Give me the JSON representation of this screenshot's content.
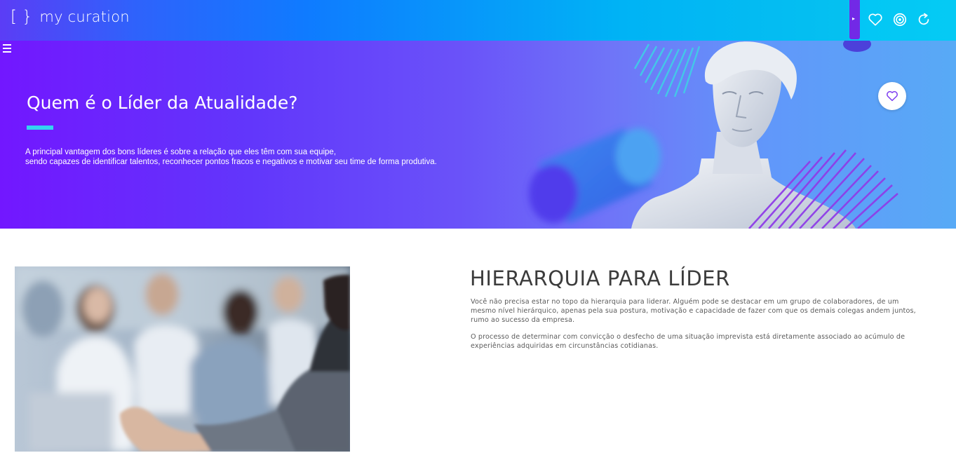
{
  "header": {
    "logo_brackets": "[ }",
    "logo_text": "my curation",
    "collapse_glyph": "▸",
    "icons": [
      "heart-icon",
      "target-icon",
      "refresh-icon"
    ]
  },
  "hero": {
    "menu_icon": "hamburger-menu-icon",
    "title": "Quem é o Líder da Atualidade?",
    "description_line1": "A principal vantagem dos bons líderes é sobre a relação que eles têm com sua equipe,",
    "description_line2": "sendo capazes de identificar talentos, reconhecer pontos fracos e negativos e motivar seu time de forma produtiva.",
    "favorite_icon": "heart-icon",
    "accent_color": "#33d3f0"
  },
  "section": {
    "title": "HIERARQUIA PARA LÍDER",
    "paragraph1": "Você não precisa estar no topo da hierarquia para liderar. Alguém pode se destacar em um grupo de colaboradores, de um mesmo nível hierárquico, apenas pela sua postura, motivação e capacidade de fazer com que os demais colegas andem juntos, rumo ao sucesso da empresa.",
    "paragraph2": "O processo de determinar com convicção o desfecho de uma situação imprevista está diretamente associado ao acúmulo de experiências adquiridas em circunstâncias cotidianas."
  },
  "colors": {
    "brand_purple": "#7229e6",
    "brand_blue": "#0f7bff",
    "brand_cyan": "#08c7ee",
    "heart_purple": "#7d3cf0"
  }
}
